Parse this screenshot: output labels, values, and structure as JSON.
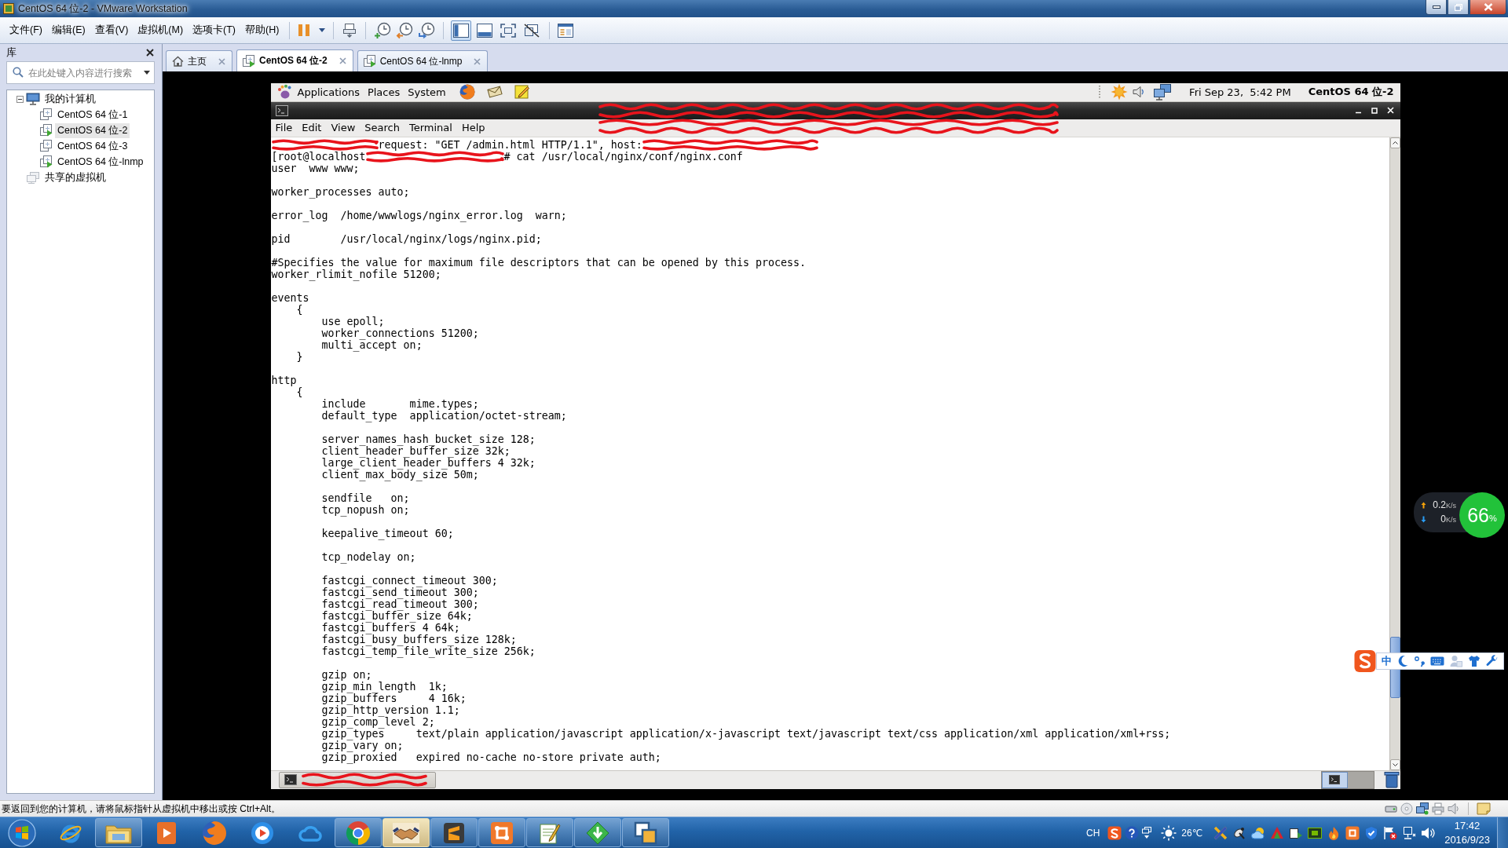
{
  "window": {
    "title": "CentOS 64 位-2 - VMware Workstation"
  },
  "menu": [
    "文件(F)",
    "编辑(E)",
    "查看(V)",
    "虚拟机(M)",
    "选项卡(T)",
    "帮助(H)"
  ],
  "toolbar": {
    "view_buttons": [
      {
        "selected": true
      },
      {
        "selected": false
      },
      {
        "selected": false
      },
      {
        "selected": false
      }
    ]
  },
  "library": {
    "title": "库",
    "search": {
      "placeholder": "在此处键入内容进行搜索"
    },
    "tree": [
      {
        "label": "我的计算机",
        "kind": "computer",
        "expanded": true,
        "selected": false,
        "children": [
          {
            "label": "CentOS 64 位-1",
            "kind": "vm",
            "running": false,
            "selected": false
          },
          {
            "label": "CentOS 64 位-2",
            "kind": "vm",
            "running": true,
            "selected": true
          },
          {
            "label": "CentOS 64 位-3",
            "kind": "vm",
            "running": false,
            "selected": false
          },
          {
            "label": "CentOS 64 位-lnmp",
            "kind": "vm",
            "running": true,
            "selected": false
          }
        ]
      },
      {
        "label": "共享的虚拟机",
        "kind": "shared",
        "selected": false
      }
    ]
  },
  "tabs": [
    {
      "label": "主页",
      "kind": "home",
      "selected": false
    },
    {
      "label": "CentOS 64 位-2",
      "kind": "vm",
      "running": true,
      "selected": true
    },
    {
      "label": "CentOS 64 位-lnmp",
      "kind": "vm",
      "running": true,
      "selected": false
    }
  ],
  "guest": {
    "top_panel": {
      "menus": [
        "Applications",
        "Places",
        "System"
      ],
      "clock": "Fri Sep 23,  5:42 PM",
      "hostname": "CentOS 64 位-2"
    },
    "terminal": {
      "menu": [
        "File",
        "Edit",
        "View",
        "Search",
        "Terminal",
        "Help"
      ],
      "command_lines": [
        {
          "parts": [
            {
              "kind": "redacted"
            },
            {
              "kind": "text",
              "text": "request: \"GET /admin.html HTTP/1.1\", host:"
            },
            {
              "kind": "redacted"
            }
          ]
        },
        {
          "parts": [
            {
              "kind": "text",
              "text": "[root@localhost"
            },
            {
              "kind": "redacted"
            },
            {
              "kind": "text",
              "text": "# cat /usr/local/nginx/conf/nginx.conf"
            }
          ]
        }
      ],
      "blocks": [
        [
          "user  www www;"
        ],
        [
          "worker_processes auto;"
        ],
        [
          "error_log  /home/wwwlogs/nginx_error.log  warn;"
        ],
        [
          "pid        /usr/local/nginx/logs/nginx.pid;"
        ],
        [
          "#Specifies the value for maximum file descriptors that can be opened by this process.",
          "worker_rlimit_nofile 51200;"
        ],
        [
          "events",
          "    {",
          "        use epoll;",
          "        worker_connections 51200;",
          "        multi_accept on;",
          "    }"
        ],
        [
          "http",
          "    {",
          "        include       mime.types;",
          "        default_type  application/octet-stream;"
        ],
        [
          "        server_names_hash_bucket_size 128;",
          "        client_header_buffer_size 32k;",
          "        large_client_header_buffers 4 32k;",
          "        client_max_body_size 50m;"
        ],
        [
          "        sendfile   on;",
          "        tcp_nopush on;"
        ],
        [
          "        keepalive_timeout 60;"
        ],
        [
          "        tcp_nodelay on;"
        ],
        [
          "        fastcgi_connect_timeout 300;",
          "        fastcgi_send_timeout 300;",
          "        fastcgi_read_timeout 300;",
          "        fastcgi_buffer_size 64k;",
          "        fastcgi_buffers 4 64k;",
          "        fastcgi_busy_buffers_size 128k;",
          "        fastcgi_temp_file_write_size 256k;"
        ],
        [
          "        gzip on;",
          "        gzip_min_length  1k;",
          "        gzip_buffers     4 16k;",
          "        gzip_http_version 1.1;",
          "        gzip_comp_level 2;",
          "        gzip_types     text/plain application/javascript application/x-javascript text/javascript text/css application/xml application/xml+rss;",
          "        gzip_vary on;",
          "        gzip_proxied   expired no-cache no-store private auth;"
        ]
      ]
    },
    "bottom_panel": {
      "workspaces": [
        {
          "selected": true
        },
        {
          "selected": false
        }
      ]
    }
  },
  "status_bar": {
    "text": "要返回到您的计算机，请将鼠标指针从虚拟机中移出或按 Ctrl+Alt。"
  },
  "net_widget": {
    "upload": {
      "value": "0.2",
      "unit": "K/s"
    },
    "download": {
      "value": "0",
      "unit": "K/s"
    },
    "usage": {
      "value": "66",
      "unit": "%"
    }
  },
  "ime_bar": {
    "mode": "中"
  },
  "taskbar": {
    "apps": [
      {
        "running": false,
        "selected": false
      },
      {
        "running": true,
        "selected": false
      },
      {
        "running": false,
        "selected": false
      },
      {
        "running": false,
        "selected": false
      },
      {
        "running": false,
        "selected": false
      },
      {
        "running": false,
        "selected": false
      },
      {
        "running": true,
        "selected": false
      },
      {
        "running": true,
        "selected": true
      },
      {
        "running": true,
        "selected": false
      },
      {
        "running": true,
        "selected": false
      },
      {
        "running": true,
        "selected": false
      },
      {
        "running": true,
        "selected": false
      },
      {
        "running": true,
        "selected": false
      }
    ],
    "tray": {
      "language": "CH",
      "temperature": "26℃",
      "time": "17:42",
      "date": "2016/9/23"
    }
  }
}
